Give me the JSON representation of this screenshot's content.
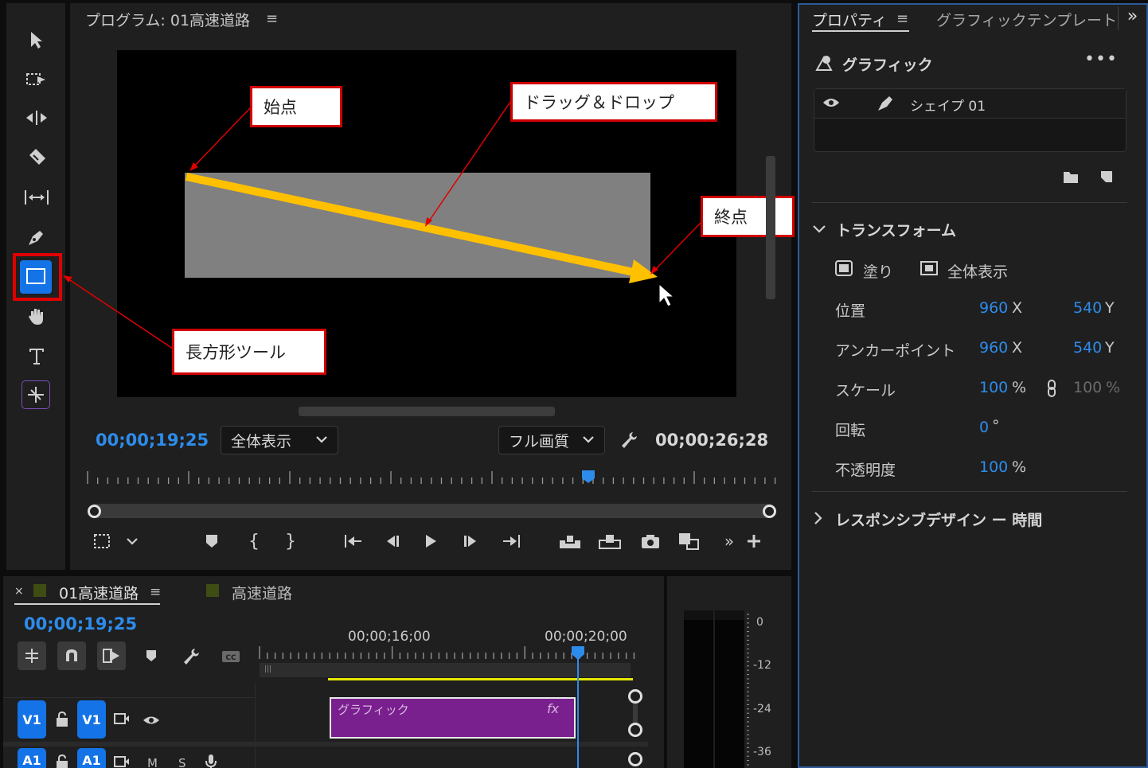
{
  "program_monitor": {
    "title": "プログラム: 01高速道路",
    "timecode_current": "00;00;19;25",
    "timecode_duration": "00;00;26;28",
    "zoom_select": "全体表示",
    "quality_select": "フル画質"
  },
  "callouts": {
    "start": "始点",
    "drag": "ドラッグ＆ドロップ",
    "end": "終点",
    "rect_tool": "長方形ツール"
  },
  "properties": {
    "tab_properties": "プロパティ",
    "tab_templates": "グラフィックテンプレート",
    "section_graphic": "グラフィック",
    "layer_name": "シェイプ 01",
    "section_transform": "トランスフォーム",
    "fill_label": "塗り",
    "fit_label": "全体表示",
    "rows": {
      "position": {
        "label": "位置",
        "x": "960",
        "x_unit": "X",
        "y": "540",
        "y_unit": "Y"
      },
      "anchor": {
        "label": "アンカーポイント",
        "x": "960",
        "x_unit": "X",
        "y": "540",
        "y_unit": "Y"
      },
      "scale": {
        "label": "スケール",
        "value": "100",
        "unit": "%",
        "value2": "100",
        "unit2": "%"
      },
      "rotation": {
        "label": "回転",
        "value": "0",
        "unit": "°"
      },
      "opacity": {
        "label": "不透明度",
        "value": "100",
        "unit": "%"
      }
    },
    "section_responsive": "レスポンシブデザイン ー 時間"
  },
  "timeline": {
    "close": "×",
    "tab_active": "01高速道路",
    "tab_other": "高速道路",
    "timecode": "00;00;19;25",
    "ruler_label_1": "00;00;16;00",
    "ruler_label_2": "00;00;20;00",
    "clip_name": "グラフィック",
    "clip_fx": "fx",
    "track_v1": "V1",
    "track_v1_target": "V1",
    "track_a1": "A1",
    "track_a1_target": "A1",
    "mute": "M",
    "solo": "S"
  },
  "audio_meter": {
    "labels": [
      "0",
      "-12",
      "-24",
      "-36"
    ]
  },
  "colors": {
    "accent_blue": "#2d8ceb",
    "clip_purple": "#7a1f8e",
    "arrow_yellow": "#ffc000",
    "callout_red": "#d10000"
  }
}
